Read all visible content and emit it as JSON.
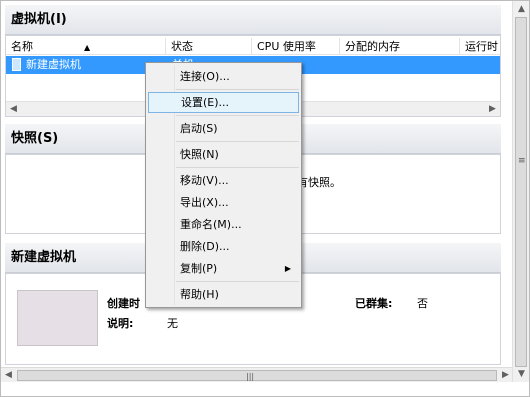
{
  "vm_section": {
    "title": "虚拟机(I)",
    "columns": [
      "名称",
      "状态",
      "CPU 使用率",
      "分配的内存",
      "运行时"
    ],
    "rows": [
      {
        "name": "新建虚拟机",
        "status": "关机"
      }
    ]
  },
  "snapshot_section": {
    "title": "快照(S)",
    "empty_text": "有快照。"
  },
  "details_section": {
    "title": "新建虚拟机",
    "created_label": "创建时",
    "notes_label": "说明:",
    "notes_value": "无",
    "clustered_label": "已群集:",
    "clustered_value": "否"
  },
  "context_menu": {
    "items": [
      {
        "label": "连接(O)..."
      },
      {
        "label": "设置(E)...",
        "highlighted": true
      },
      {
        "label": "启动(S)"
      },
      {
        "label": "快照(N)"
      },
      {
        "label": "移动(V)..."
      },
      {
        "label": "导出(X)..."
      },
      {
        "label": "重命名(M)..."
      },
      {
        "label": "删除(D)..."
      },
      {
        "label": "复制(P)",
        "submenu": true
      },
      {
        "label": "帮助(H)"
      }
    ]
  },
  "colors": {
    "selection": "#3399ff",
    "menu_highlight": "#e5f3fb",
    "menu_highlight_border": "#7fb4e4"
  },
  "icons": {
    "sort": "sort-ascending-icon",
    "scroll_left": "arrow-left-icon",
    "scroll_right": "arrow-right-icon",
    "scroll_up": "arrow-up-icon",
    "scroll_down": "arrow-down-icon",
    "submenu": "chevron-right-icon"
  }
}
